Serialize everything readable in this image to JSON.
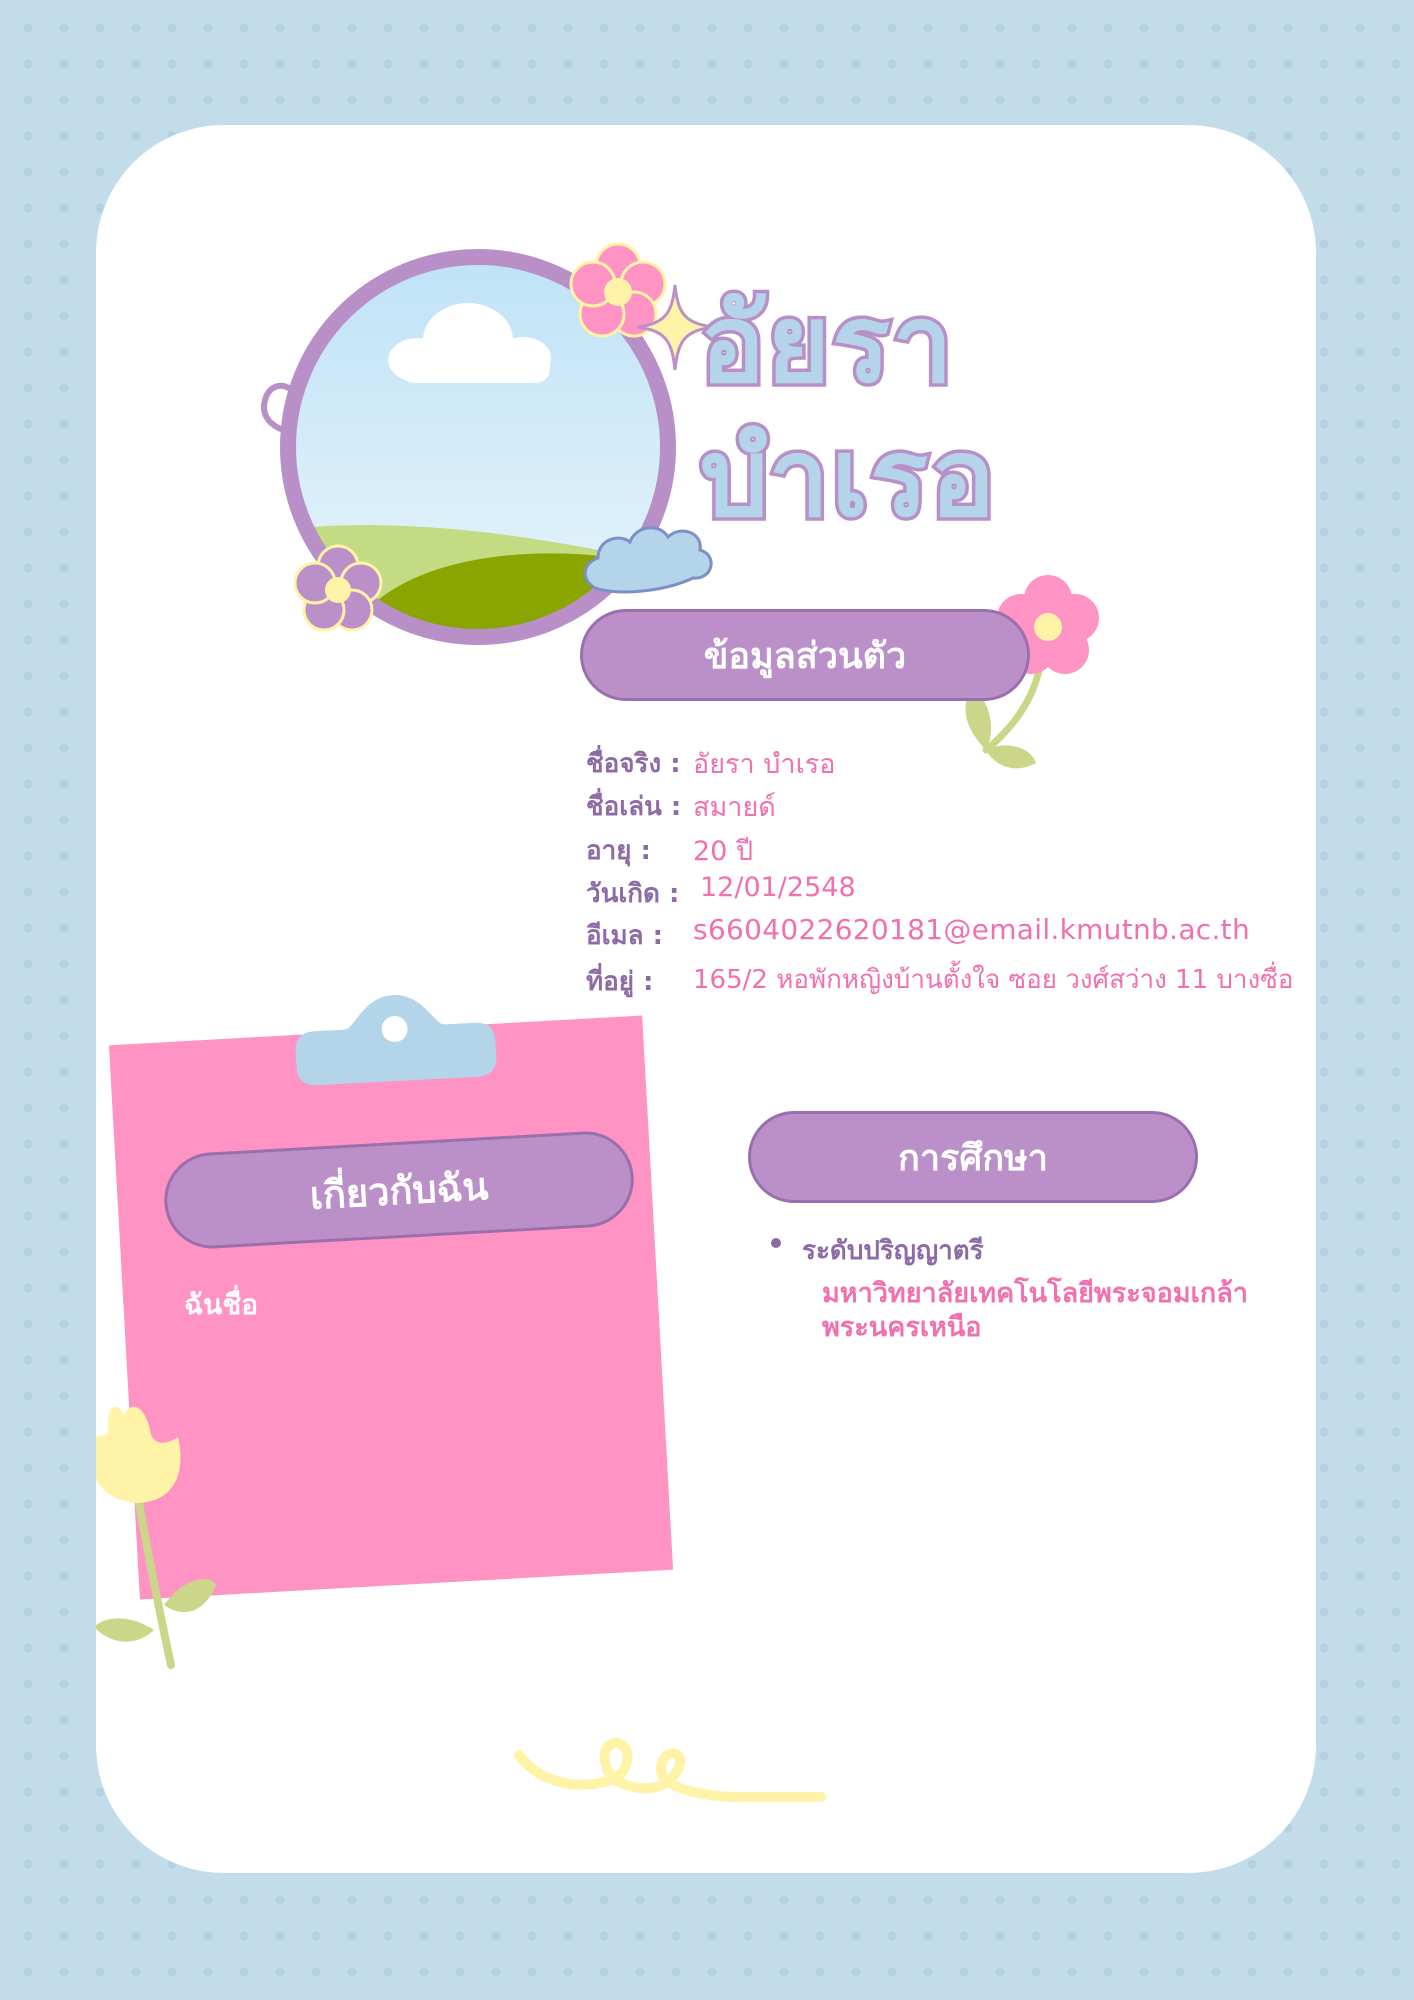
{
  "header": {
    "first_name": "อัยรา",
    "last_name": "บำเรอ"
  },
  "personal": {
    "title": "ข้อมูลส่วนตัว",
    "fields": [
      {
        "label": "ชื่อจริง :",
        "value": "อัยรา บำเรอ"
      },
      {
        "label": "ชื่อเล่น :",
        "value": "สมายด์"
      },
      {
        "label": "อายุ :",
        "value": "20 ปี"
      },
      {
        "label": "วันเกิด :",
        "value": "12/01/2548"
      },
      {
        "label": "อีเมล :",
        "value": "s6604022620181@email.kmutnb.ac.th"
      },
      {
        "label": "ที่อยู่ :",
        "value": "165/2 หอพักหญิงบ้านตั้งใจ ซอย วงศ์สว่าง 11 บางซื่อ"
      }
    ]
  },
  "about": {
    "title": "เกี่ยวกับฉัน",
    "body": "ฉันชื่อ"
  },
  "education": {
    "title": "การศึกษา",
    "level": "ระดับปริญญาตรี",
    "school_line1": "มหาวิทยาลัยเทคโนโลยีพระจอมเกล้า",
    "school_line2": "พระนครเหนือ"
  },
  "colors": {
    "background": "#c2dcea",
    "card": "#ffffff",
    "accent_purple": "#bb90c9",
    "accent_pink": "#ff93c4",
    "text_pink": "#f070b0",
    "text_purple": "#8e6aa6",
    "name_fill": "#b4d4ea",
    "flower_yellow": "#fff3a8",
    "leaf_green": "#cbd68a"
  },
  "icons": [
    "cloud-icon",
    "flower-icon",
    "sparkle-icon",
    "swirl-icon",
    "tulip-icon",
    "clip-icon"
  ]
}
